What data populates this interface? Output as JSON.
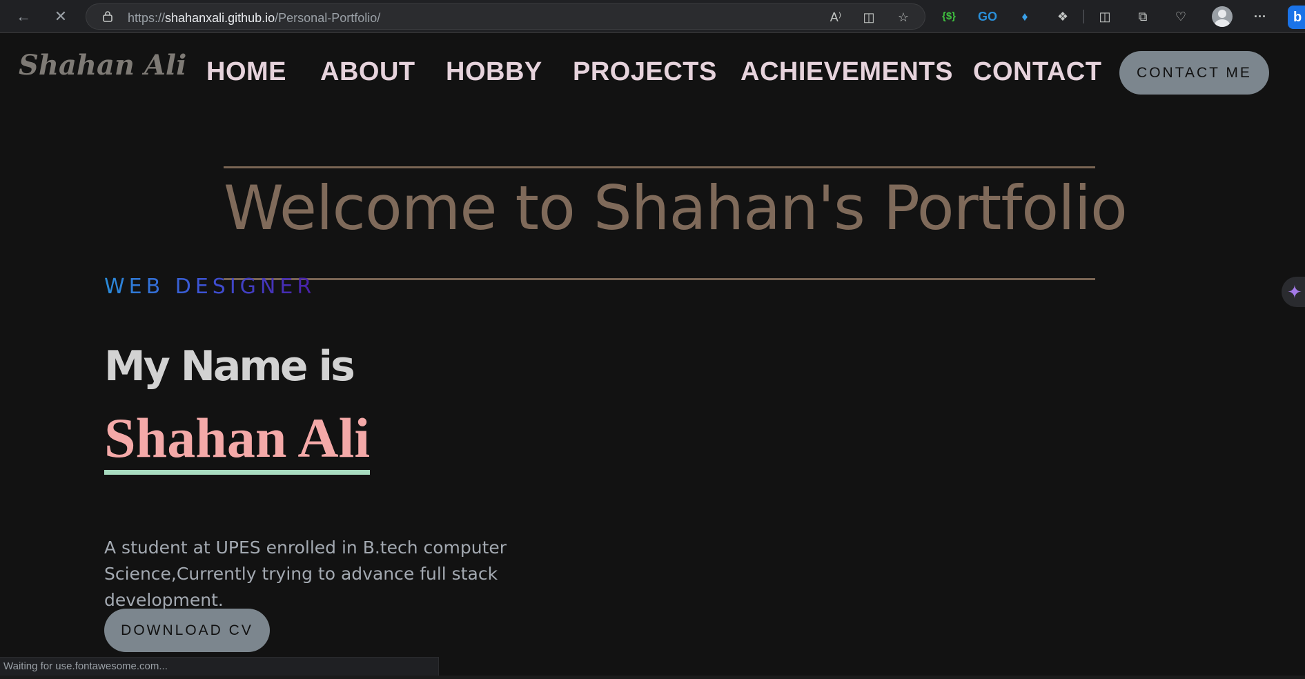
{
  "browser": {
    "url_prefix": "https://",
    "url_host": "shahanxali.github.io",
    "url_path": "/Personal-Portfolio/",
    "back_icon": "arrow-left-icon",
    "stop_icon": "close-icon",
    "read_aloud_label": "A⁾",
    "menu_label": "···",
    "ext1_label": "{$}",
    "ext2_label": "GO",
    "status_text": "Waiting for use.fontawesome.com...",
    "bing_label": "b"
  },
  "site": {
    "logo": "Shahan Ali",
    "nav": [
      "HOME",
      "ABOUT",
      "HOBBY",
      "PROJECTS",
      "ACHIEVEMENTS",
      "CONTACT"
    ],
    "contact_button": "CONTACT ME"
  },
  "hero": {
    "welcome": "Welcome to Shahan's Portfolio",
    "role": "WEB DESIGNER",
    "intro": "My Name is",
    "name": "Shahan Ali",
    "bio": "A student at UPES enrolled in B.tech computer Science,Currently trying to advance full stack development.",
    "download_button": "DOWNLOAD CV"
  },
  "colors": {
    "background": "#121212",
    "nav_text": "#e6d3dc",
    "welcome": "#7f6a5a",
    "name": "#f4a9a8",
    "name_underline": "#a8dcc0",
    "button": "#7c868e"
  }
}
